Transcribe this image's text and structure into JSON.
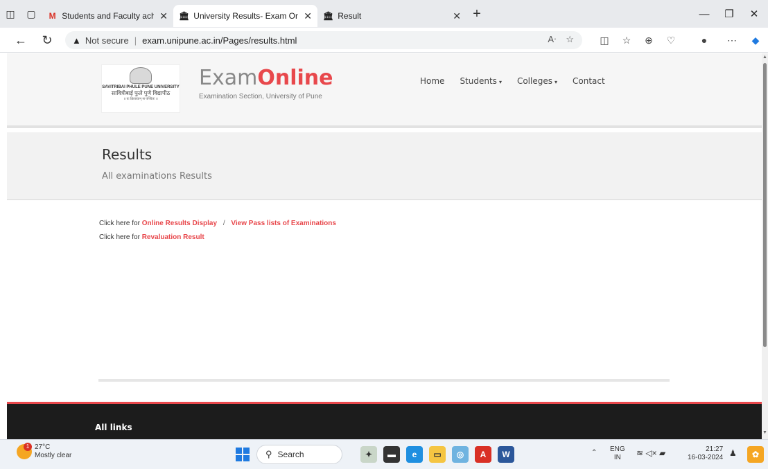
{
  "browser": {
    "tabs": [
      {
        "label": "Students and Faculty achieveme",
        "favicon": "M"
      },
      {
        "label": "University Results- Exam Online,",
        "favicon": "🏛"
      },
      {
        "label": "Result",
        "favicon": "🏛"
      }
    ],
    "address": {
      "security_label": "Not secure",
      "url": "exam.unipune.ac.in/Pages/results.html"
    }
  },
  "site": {
    "logo": {
      "line1": "SAVITRIBAI PHULE PUNE UNIVERSITY",
      "line2": "सावित्रीबाई फुले पुणे विद्यापीठ",
      "line3": "॥ यः क्रियावान् स पण्डितः ॥"
    },
    "brand": {
      "part1": "Exam",
      "part2": "Online",
      "subtitle": "Examination Section, University of Pune"
    },
    "nav": {
      "home": "Home",
      "students": "Students",
      "colleges": "Colleges",
      "contact": "Contact"
    },
    "page": {
      "title": "Results",
      "subtitle": "All examinations Results"
    },
    "content": {
      "prefix1": "Click here for",
      "link_online": "Online Results Display",
      "separator": "/",
      "link_pass": "View Pass lists of Examinations",
      "prefix2": "Click here for",
      "link_reval": "Revaluation Result"
    },
    "footer": {
      "all_links": "All links"
    }
  },
  "taskbar": {
    "weather": {
      "temp": "27°C",
      "condition": "Mostly clear",
      "badge": "1"
    },
    "search_label": "Search",
    "lang": {
      "line1": "ENG",
      "line2": "IN"
    },
    "clock": {
      "time": "21:27",
      "date": "16-03-2024"
    }
  },
  "colors": {
    "accent": "#e8484c",
    "footer_bg": "#1c1c1c"
  }
}
